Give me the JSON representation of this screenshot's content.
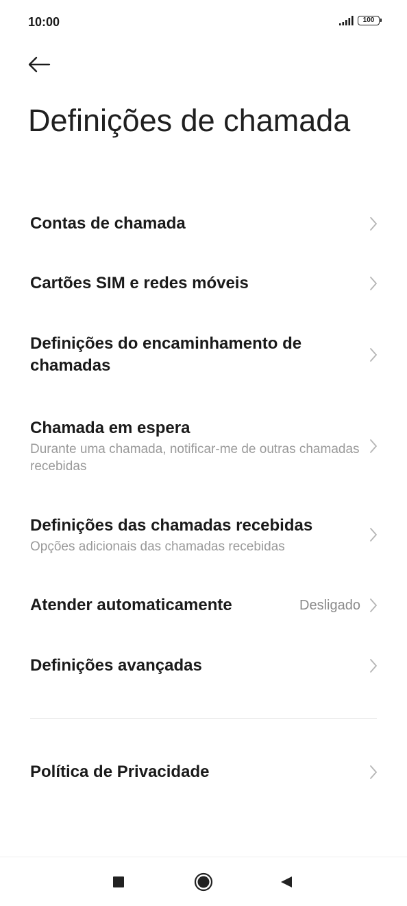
{
  "status_bar": {
    "time": "10:00",
    "battery": "100",
    "icons": [
      "signal-icon",
      "battery-icon"
    ]
  },
  "header": {
    "back_icon": "arrow-left-icon",
    "title": "Definições de chamada"
  },
  "items": [
    {
      "title": "Contas de chamada",
      "subtitle": "",
      "value": ""
    },
    {
      "title": "Cartões SIM e redes móveis",
      "subtitle": "",
      "value": ""
    },
    {
      "title": "Definições do encaminhamento de chamadas",
      "subtitle": "",
      "value": ""
    },
    {
      "title": "Chamada em espera",
      "subtitle": "Durante uma chamada, notificar-me de outras chamadas recebidas",
      "value": ""
    },
    {
      "title": "Definições das chamadas recebidas",
      "subtitle": "Opções adicionais das chamadas recebidas",
      "value": ""
    },
    {
      "title": "Atender automaticamente",
      "subtitle": "",
      "value": "Desligado"
    },
    {
      "title": "Definições avançadas",
      "subtitle": "",
      "value": ""
    },
    {
      "title": "Política de Privacidade",
      "subtitle": "",
      "value": ""
    }
  ],
  "nav_bar": {
    "icons": [
      "recents-icon",
      "home-icon",
      "back-triangle-icon"
    ]
  },
  "colors": {
    "title_text": "#1a1a1a",
    "subtitle_text": "#9a9a9a",
    "chevron": "#b5b5b5",
    "divider": "#e6e6e6"
  }
}
